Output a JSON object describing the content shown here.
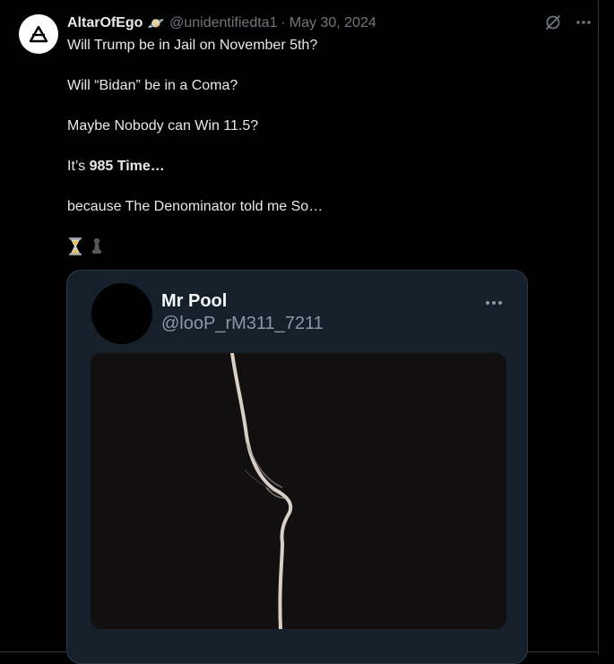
{
  "post": {
    "display_name": "AltarOfEgo",
    "badge_emoji": "🪐",
    "handle": "@unidentifiedta1",
    "separator": "·",
    "date": "May 30, 2024",
    "lines": {
      "line1": "Will Trump be in Jail on November 5th?",
      "line2": "Will “Bidan” be in a Coma?",
      "line3": "Maybe Nobody can Win 11.5?",
      "line4_prefix": "It’s ",
      "line4_bold": "985 Time…",
      "line5": "because The Denominator told me So…"
    },
    "emojis": [
      "hourglass-emoji",
      "chess-pawn-emoji"
    ]
  },
  "quoted": {
    "name": "Mr Pool",
    "handle": "@looP_rM311_7211",
    "media_description_icon": "dark-silhouette-photo"
  },
  "colors": {
    "background": "#000000",
    "text": "#e7e9ea",
    "muted": "#71767b",
    "card_bg": "#15202b",
    "card_muted": "#8b98a5"
  },
  "icons": {
    "avatar": "alchemy-triangle-icon",
    "grok": "grok-icon",
    "more": "more-icon",
    "card_more": "more-icon"
  }
}
